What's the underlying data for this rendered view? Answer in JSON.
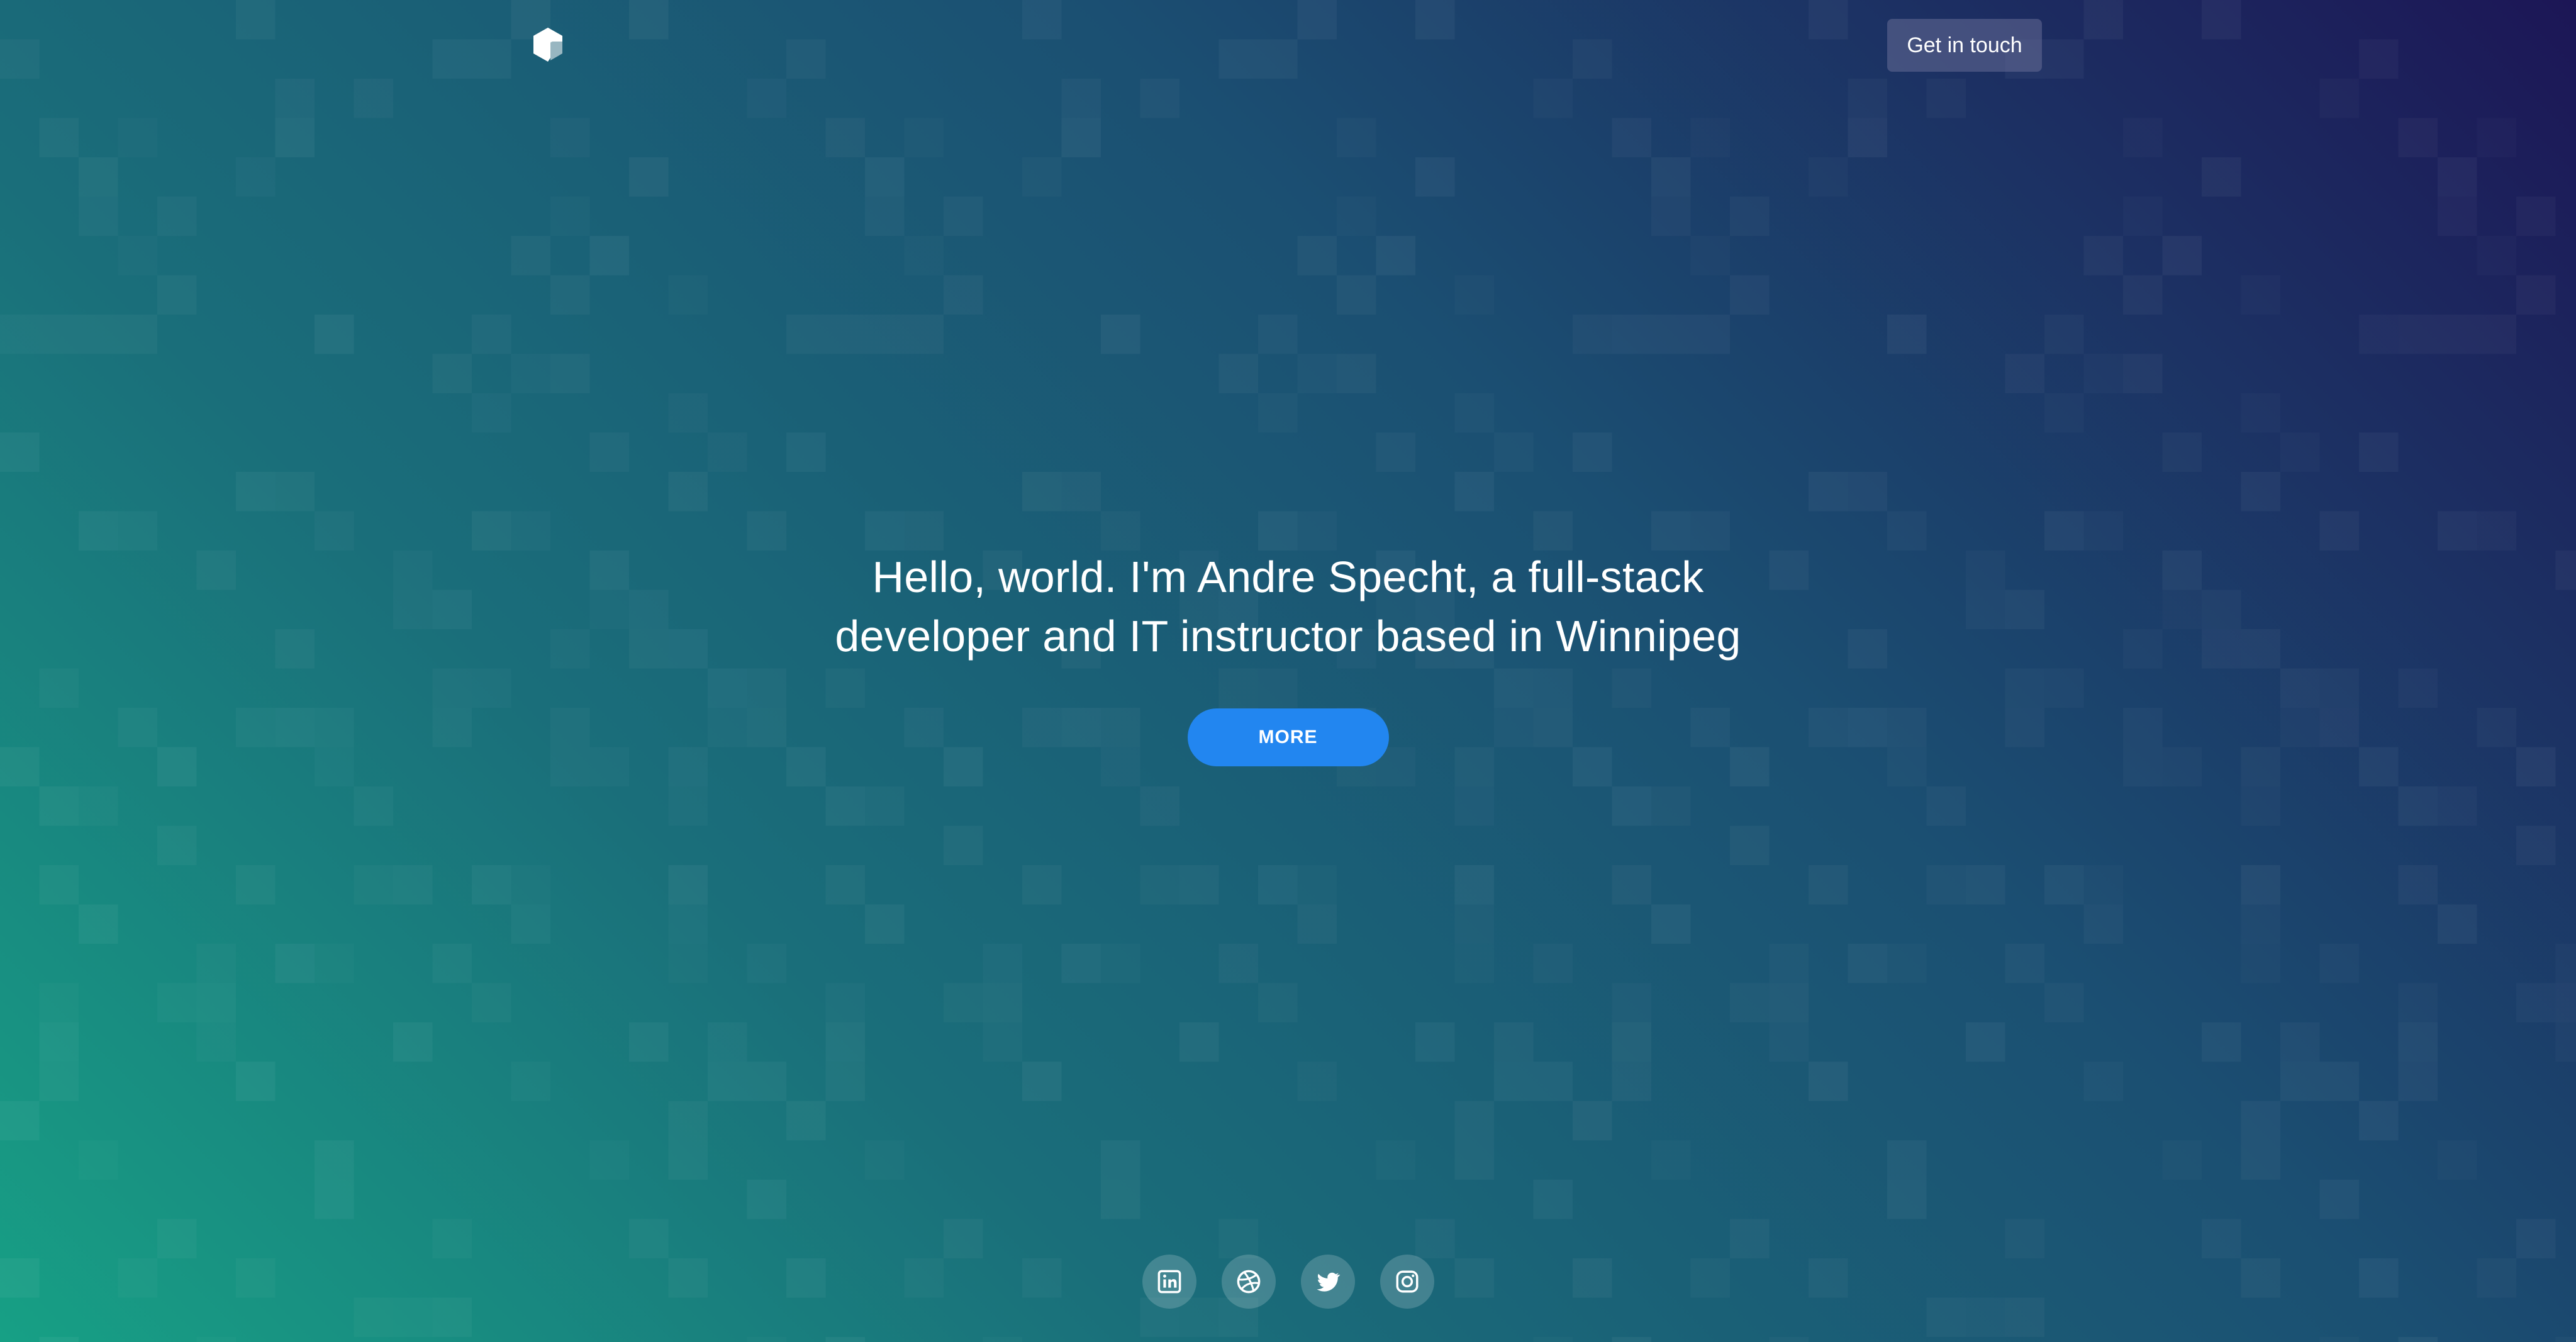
{
  "header": {
    "logo_icon": "cube-logo-icon",
    "cta_label": "Get in touch"
  },
  "hero": {
    "title_line1": "Hello, world. I'm Andre Specht, a full-stack",
    "title_line2": "developer and IT instructor based in Winnipeg",
    "more_label": "MORE"
  },
  "social": [
    {
      "name": "linkedin",
      "icon": "linkedin-icon"
    },
    {
      "name": "dribbble",
      "icon": "dribbble-icon"
    },
    {
      "name": "twitter",
      "icon": "twitter-icon"
    },
    {
      "name": "instagram",
      "icon": "instagram-icon"
    }
  ],
  "colors": {
    "gradient_start": "#17a085",
    "gradient_end": "#1c1656",
    "accent_button": "#2286f0"
  }
}
